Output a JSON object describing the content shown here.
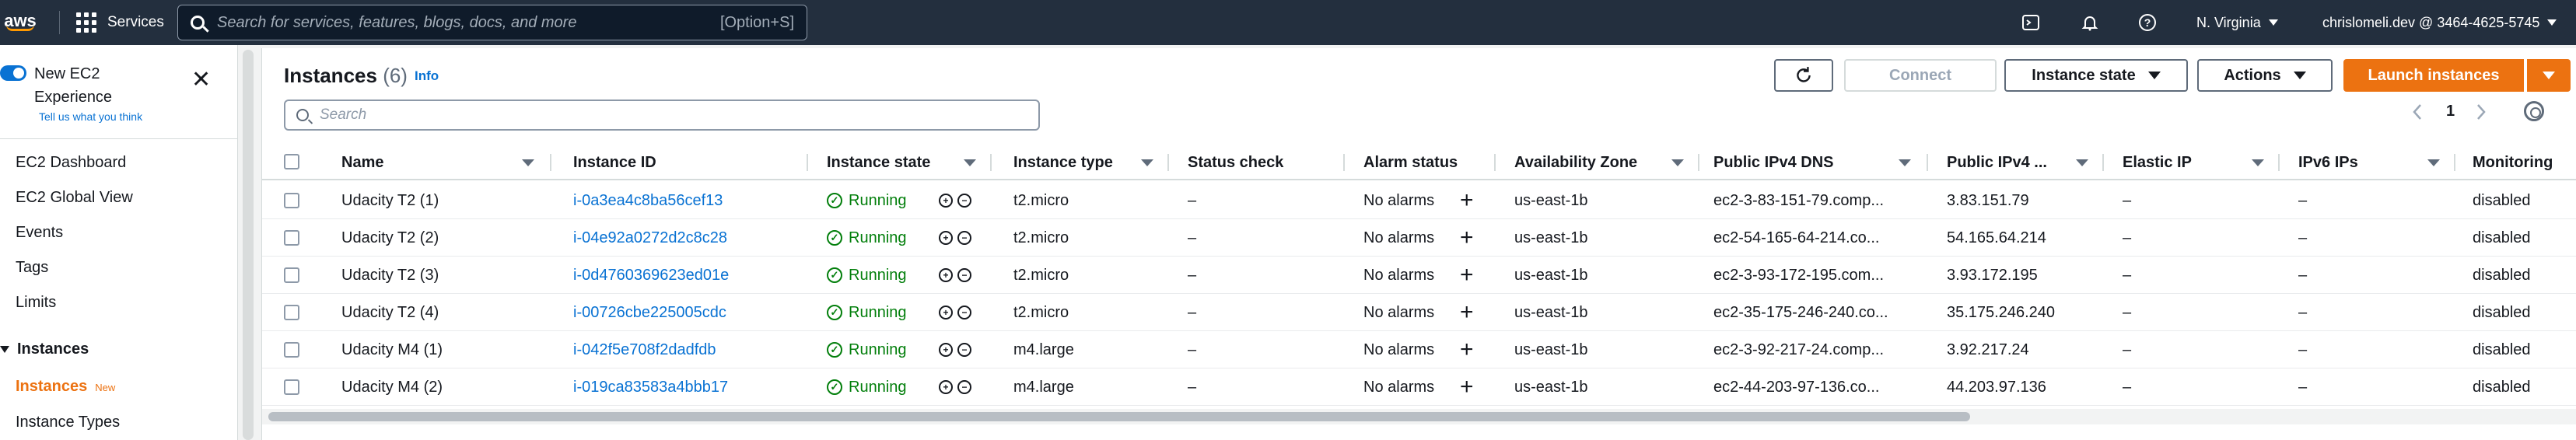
{
  "topnav": {
    "logo": "aws",
    "services": "Services",
    "search_placeholder": "Search for services, features, blogs, docs, and more",
    "search_shortcut": "[Option+S]",
    "region": "N. Virginia",
    "account": "chrislomeli.dev @ 3464-4625-5745"
  },
  "sidebar": {
    "new_experience": "New EC2 Experience",
    "tell_us": "Tell us what you think",
    "items": [
      "EC2 Dashboard",
      "EC2 Global View",
      "Events",
      "Tags",
      "Limits"
    ],
    "section": "Instances",
    "active_item": "Instances",
    "active_badge": "New",
    "next_item": "Instance Types"
  },
  "panel": {
    "title": "Instances",
    "count": "(6)",
    "info": "Info",
    "connect": "Connect",
    "instance_state": "Instance state",
    "actions": "Actions",
    "launch": "Launch instances",
    "search_placeholder": "Search",
    "page": "1"
  },
  "table": {
    "headers": [
      "Name",
      "Instance ID",
      "Instance state",
      "Instance type",
      "Status check",
      "Alarm status",
      "Availability Zone",
      "Public IPv4 DNS",
      "Public IPv4 ...",
      "Elastic IP",
      "IPv6 IPs",
      "Monitoring"
    ],
    "rows": [
      {
        "name": "Udacity T2 (1)",
        "id": "i-0a3ea4c8ba56cef13",
        "state": "Running",
        "type": "t2.micro",
        "status": "–",
        "alarm": "No alarms",
        "az": "us-east-1b",
        "dns": "ec2-3-83-151-79.comp...",
        "ip": "3.83.151.79",
        "eip": "–",
        "ipv6": "–",
        "monitoring": "disabled"
      },
      {
        "name": "Udacity T2 (2)",
        "id": "i-04e92a0272d2c8c28",
        "state": "Running",
        "type": "t2.micro",
        "status": "–",
        "alarm": "No alarms",
        "az": "us-east-1b",
        "dns": "ec2-54-165-64-214.co...",
        "ip": "54.165.64.214",
        "eip": "–",
        "ipv6": "–",
        "monitoring": "disabled"
      },
      {
        "name": "Udacity T2 (3)",
        "id": "i-0d4760369623ed01e",
        "state": "Running",
        "type": "t2.micro",
        "status": "–",
        "alarm": "No alarms",
        "az": "us-east-1b",
        "dns": "ec2-3-93-172-195.com...",
        "ip": "3.93.172.195",
        "eip": "–",
        "ipv6": "–",
        "monitoring": "disabled"
      },
      {
        "name": "Udacity T2 (4)",
        "id": "i-00726cbe225005cdc",
        "state": "Running",
        "type": "t2.micro",
        "status": "–",
        "alarm": "No alarms",
        "az": "us-east-1b",
        "dns": "ec2-35-175-246-240.co...",
        "ip": "35.175.246.240",
        "eip": "–",
        "ipv6": "–",
        "monitoring": "disabled"
      },
      {
        "name": "Udacity M4 (1)",
        "id": "i-042f5e708f2dadfdb",
        "state": "Running",
        "type": "m4.large",
        "status": "–",
        "alarm": "No alarms",
        "az": "us-east-1b",
        "dns": "ec2-3-92-217-24.comp...",
        "ip": "3.92.217.24",
        "eip": "–",
        "ipv6": "–",
        "monitoring": "disabled"
      },
      {
        "name": "Udacity M4 (2)",
        "id": "i-019ca83583a4bbb17",
        "state": "Running",
        "type": "m4.large",
        "status": "–",
        "alarm": "No alarms",
        "az": "us-east-1b",
        "dns": "ec2-44-203-97-136.co...",
        "ip": "44.203.97.136",
        "eip": "–",
        "ipv6": "–",
        "monitoring": "disabled"
      }
    ]
  },
  "colors": {
    "nav_bg": "#232f3e",
    "accent_orange": "#ec7211",
    "link_blue": "#0972d3",
    "running_green": "#037f0c"
  }
}
